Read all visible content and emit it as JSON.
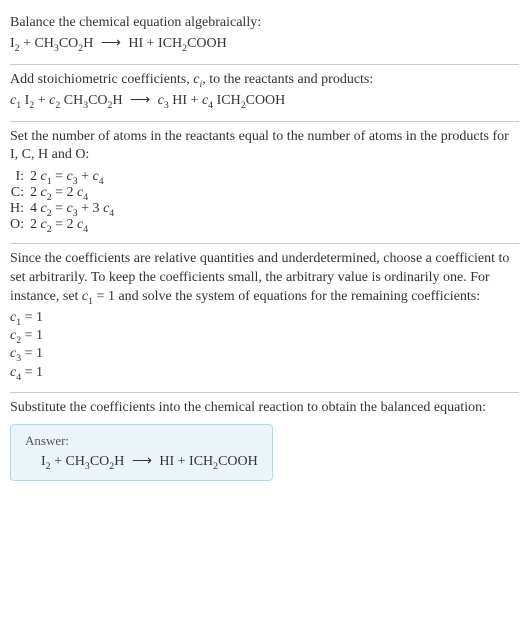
{
  "section1": {
    "title": "Balance the chemical equation algebraically:",
    "reaction_html": "I<span class='sub'>2</span> + CH<span class='sub'>3</span>CO<span class='sub'>2</span>H <span class='arrow'>⟶</span> HI + ICH<span class='sub'>2</span>COOH"
  },
  "section2": {
    "text_html": "Add stoichiometric coefficients, <span class='ital'>c<span class='sub'>i</span></span>, to the reactants and products:",
    "reaction_html": "<span class='ital'>c</span><span class='sub'>1</span> I<span class='sub'>2</span> + <span class='ital'>c</span><span class='sub'>2</span> CH<span class='sub'>3</span>CO<span class='sub'>2</span>H <span class='arrow'>⟶</span> <span class='ital'>c</span><span class='sub'>3</span> HI + <span class='ital'>c</span><span class='sub'>4</span> ICH<span class='sub'>2</span>COOH"
  },
  "section3": {
    "text": "Set the number of atoms in the reactants equal to the number of atoms in the products for I, C, H and O:",
    "rows": [
      {
        "label": "I:",
        "eq_html": "2 <span class='ital'>c</span><span class='sub'>1</span> = <span class='ital'>c</span><span class='sub'>3</span> + <span class='ital'>c</span><span class='sub'>4</span>"
      },
      {
        "label": "C:",
        "eq_html": "2 <span class='ital'>c</span><span class='sub'>2</span> = 2 <span class='ital'>c</span><span class='sub'>4</span>"
      },
      {
        "label": "H:",
        "eq_html": "4 <span class='ital'>c</span><span class='sub'>2</span> = <span class='ital'>c</span><span class='sub'>3</span> + 3 <span class='ital'>c</span><span class='sub'>4</span>"
      },
      {
        "label": "O:",
        "eq_html": "2 <span class='ital'>c</span><span class='sub'>2</span> = 2 <span class='ital'>c</span><span class='sub'>4</span>"
      }
    ]
  },
  "section4": {
    "text_html": "Since the coefficients are relative quantities and underdetermined, choose a coefficient to set arbitrarily. To keep the coefficients small, the arbitrary value is ordinarily one. For instance, set <span class='ital'>c</span><span class='sub'>1</span> = 1 and solve the system of equations for the remaining coefficients:",
    "coeffs": [
      "<span class='ital'>c</span><span class='sub'>1</span> = 1",
      "<span class='ital'>c</span><span class='sub'>2</span> = 1",
      "<span class='ital'>c</span><span class='sub'>3</span> = 1",
      "<span class='ital'>c</span><span class='sub'>4</span> = 1"
    ]
  },
  "section5": {
    "text": "Substitute the coefficients into the chemical reaction to obtain the balanced equation:",
    "answer_label": "Answer:",
    "answer_html": "I<span class='sub'>2</span> + CH<span class='sub'>3</span>CO<span class='sub'>2</span>H <span class='arrow'>⟶</span> HI + ICH<span class='sub'>2</span>COOH"
  }
}
